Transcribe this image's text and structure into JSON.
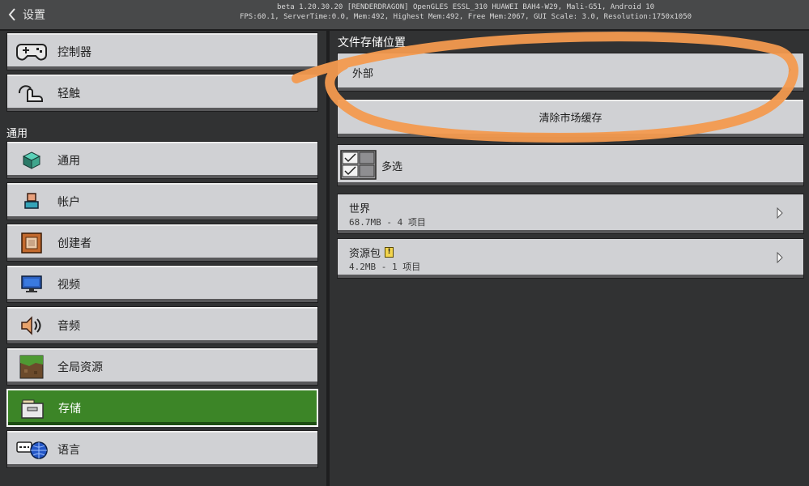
{
  "header": {
    "back_label": "设置",
    "debug_line1": "beta 1.20.30.20 [RENDERDRAGON] OpenGLES ESSL_310 HUAWEI BAH4-W29, Mali-G51, Android 10",
    "debug_line2": "FPS:60.1, ServerTime:0.0, Mem:492, Highest Mem:492, Free Mem:2067, GUI Scale: 3.0, Resolution:1750x1050"
  },
  "sidebar": {
    "top_items": [
      {
        "label": "控制器",
        "icon": "controller-icon"
      },
      {
        "label": "轻触",
        "icon": "touch-icon"
      }
    ],
    "section_header": "通用",
    "items": [
      {
        "label": "通用",
        "icon": "cube-icon"
      },
      {
        "label": "帐户",
        "icon": "account-icon"
      },
      {
        "label": "创建者",
        "icon": "creator-icon"
      },
      {
        "label": "视频",
        "icon": "monitor-icon"
      },
      {
        "label": "音频",
        "icon": "speaker-icon"
      },
      {
        "label": "全局资源",
        "icon": "grass-block-icon"
      },
      {
        "label": "存储",
        "icon": "storage-icon",
        "active": true
      },
      {
        "label": "语言",
        "icon": "language-icon"
      }
    ]
  },
  "main": {
    "file_storage_label": "文件存储位置",
    "storage_location": "外部",
    "clear_cache_label": "清除市场缓存",
    "multiselect_label": "多选",
    "entries": [
      {
        "title": "世界",
        "subtitle": "68.7MB - 4 项目",
        "warning": false
      },
      {
        "title": "资源包",
        "subtitle": "4.2MB - 1 项目",
        "warning": true
      }
    ]
  },
  "colors": {
    "active_green": "#3c8527",
    "button_gray": "#d0d1d4",
    "annotation_orange": "#f39a4f"
  }
}
